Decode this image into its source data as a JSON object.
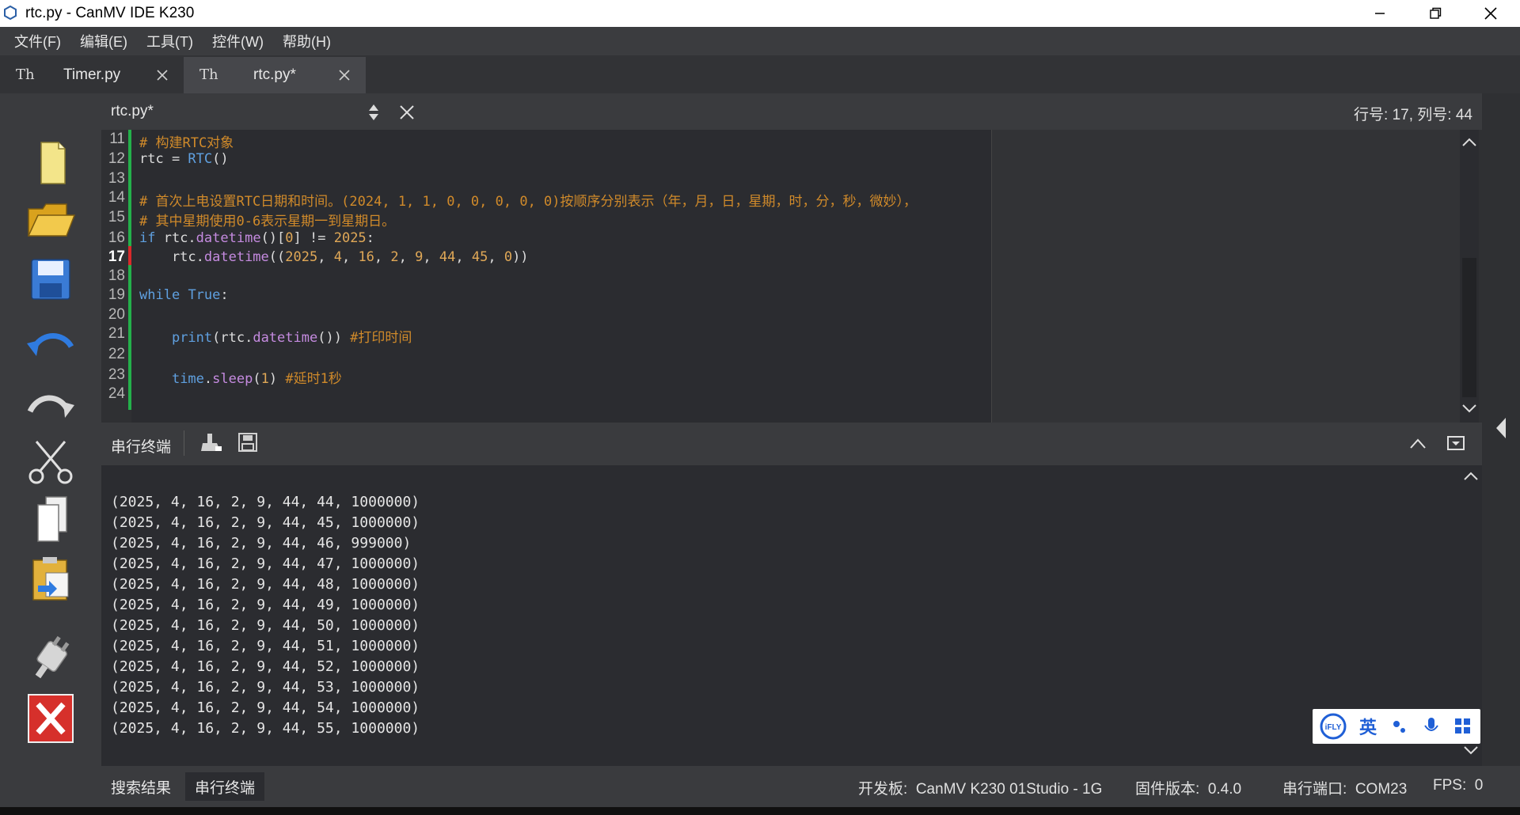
{
  "window": {
    "title": "rtc.py - CanMV IDE K230"
  },
  "menu": [
    "文件(F)",
    "编辑(E)",
    "工具(T)",
    "控件(W)",
    "帮助(H)"
  ],
  "tabs": [
    {
      "icon": "Th",
      "label": "Timer.py"
    },
    {
      "icon": "Th",
      "label": "rtc.py*"
    }
  ],
  "editor": {
    "filename": "rtc.py*",
    "position": "行号: 17, 列号: 44",
    "lines": [
      {
        "n": "11",
        "parts": [
          {
            "t": "# 构建RTC对象",
            "c": "c-com"
          }
        ]
      },
      {
        "n": "12",
        "parts": [
          {
            "t": "rtc = ",
            "c": "c-id"
          },
          {
            "t": "RTC",
            "c": "c-kw"
          },
          {
            "t": "()",
            "c": "c-id"
          }
        ]
      },
      {
        "n": "13",
        "parts": []
      },
      {
        "n": "14",
        "parts": [
          {
            "t": "# 首次上电设置RTC日期和时间。(2024, 1, 1, 0, 0, 0, 0, 0)按顺序分别表示（年，月，日，星期，时，分，秒，微妙），",
            "c": "c-com"
          }
        ]
      },
      {
        "n": "15",
        "parts": [
          {
            "t": "# 其中星期使用0-6表示星期一到星期日。",
            "c": "c-com"
          }
        ]
      },
      {
        "n": "16",
        "parts": [
          {
            "t": "if",
            "c": "c-kw"
          },
          {
            "t": " rtc.",
            "c": "c-id"
          },
          {
            "t": "datetime",
            "c": "c-fn"
          },
          {
            "t": "()[",
            "c": "c-id"
          },
          {
            "t": "0",
            "c": "c-num"
          },
          {
            "t": "] != ",
            "c": "c-id"
          },
          {
            "t": "2025",
            "c": "c-num"
          },
          {
            "t": ":",
            "c": "c-id"
          }
        ]
      },
      {
        "n": "17",
        "parts": [
          {
            "t": "    rtc.",
            "c": "c-id"
          },
          {
            "t": "datetime",
            "c": "c-fn"
          },
          {
            "t": "((",
            "c": "c-id"
          },
          {
            "t": "2025",
            "c": "c-num"
          },
          {
            "t": ", ",
            "c": "c-id"
          },
          {
            "t": "4",
            "c": "c-num"
          },
          {
            "t": ", ",
            "c": "c-id"
          },
          {
            "t": "16",
            "c": "c-num"
          },
          {
            "t": ", ",
            "c": "c-id"
          },
          {
            "t": "2",
            "c": "c-num"
          },
          {
            "t": ", ",
            "c": "c-id"
          },
          {
            "t": "9",
            "c": "c-num"
          },
          {
            "t": ", ",
            "c": "c-id"
          },
          {
            "t": "44",
            "c": "c-num"
          },
          {
            "t": ", ",
            "c": "c-id"
          },
          {
            "t": "45",
            "c": "c-num"
          },
          {
            "t": ", ",
            "c": "c-id"
          },
          {
            "t": "0",
            "c": "c-num"
          },
          {
            "t": "))",
            "c": "c-id"
          }
        ]
      },
      {
        "n": "18",
        "parts": []
      },
      {
        "n": "19",
        "parts": [
          {
            "t": "while",
            "c": "c-kw"
          },
          {
            "t": " ",
            "c": "c-id"
          },
          {
            "t": "True",
            "c": "c-kw"
          },
          {
            "t": ":",
            "c": "c-id"
          }
        ]
      },
      {
        "n": "20",
        "parts": []
      },
      {
        "n": "21",
        "parts": [
          {
            "t": "    ",
            "c": "c-id"
          },
          {
            "t": "print",
            "c": "c-kw"
          },
          {
            "t": "(rtc.",
            "c": "c-id"
          },
          {
            "t": "datetime",
            "c": "c-fn"
          },
          {
            "t": "()) ",
            "c": "c-id"
          },
          {
            "t": "#打印时间",
            "c": "c-com"
          }
        ]
      },
      {
        "n": "22",
        "parts": []
      },
      {
        "n": "23",
        "parts": [
          {
            "t": "    ",
            "c": "c-id"
          },
          {
            "t": "time",
            "c": "c-kw"
          },
          {
            "t": ".",
            "c": "c-id"
          },
          {
            "t": "sleep",
            "c": "c-fn"
          },
          {
            "t": "(",
            "c": "c-id"
          },
          {
            "t": "1",
            "c": "c-num"
          },
          {
            "t": ") ",
            "c": "c-id"
          },
          {
            "t": "#延时1秒",
            "c": "c-com"
          }
        ]
      },
      {
        "n": "24",
        "parts": []
      }
    ],
    "current_line": "17",
    "modified_line": "17"
  },
  "terminal": {
    "title": "串行终端",
    "lines": [
      "(2025, 4, 16, 2, 9, 44, 44, 1000000)",
      "(2025, 4, 16, 2, 9, 44, 45, 1000000)",
      "(2025, 4, 16, 2, 9, 44, 46, 999000)",
      "(2025, 4, 16, 2, 9, 44, 47, 1000000)",
      "(2025, 4, 16, 2, 9, 44, 48, 1000000)",
      "(2025, 4, 16, 2, 9, 44, 49, 1000000)",
      "(2025, 4, 16, 2, 9, 44, 50, 1000000)",
      "(2025, 4, 16, 2, 9, 44, 51, 1000000)",
      "(2025, 4, 16, 2, 9, 44, 52, 1000000)",
      "(2025, 4, 16, 2, 9, 44, 53, 1000000)",
      "(2025, 4, 16, 2, 9, 44, 54, 1000000)",
      "(2025, 4, 16, 2, 9, 44, 55, 1000000)"
    ]
  },
  "ime": {
    "items": [
      "iFLY",
      "英",
      "•,",
      "mic",
      "grid"
    ],
    "lang": "英"
  },
  "status": {
    "tab_search": "搜索结果",
    "tab_terminal": "串行终端",
    "board": "开发板:  CanMV K230 01Studio - 1G",
    "firmware": "固件版本:  0.4.0",
    "port": "串行端口:  COM23",
    "fps": "FPS:  0"
  },
  "colors": {
    "comment": "#d08a2a",
    "keyword": "#5fa0e0",
    "function": "#c58be0",
    "number": "#e0a857",
    "gutter_ok": "#23b04a",
    "gutter_modified": "#d9292a"
  },
  "icons": [
    "new-file-icon",
    "open-folder-icon",
    "save-icon",
    "undo-icon",
    "redo-icon",
    "cut-icon",
    "copy-icon",
    "paste-icon",
    "connect-plug-icon",
    "stop-icon"
  ]
}
